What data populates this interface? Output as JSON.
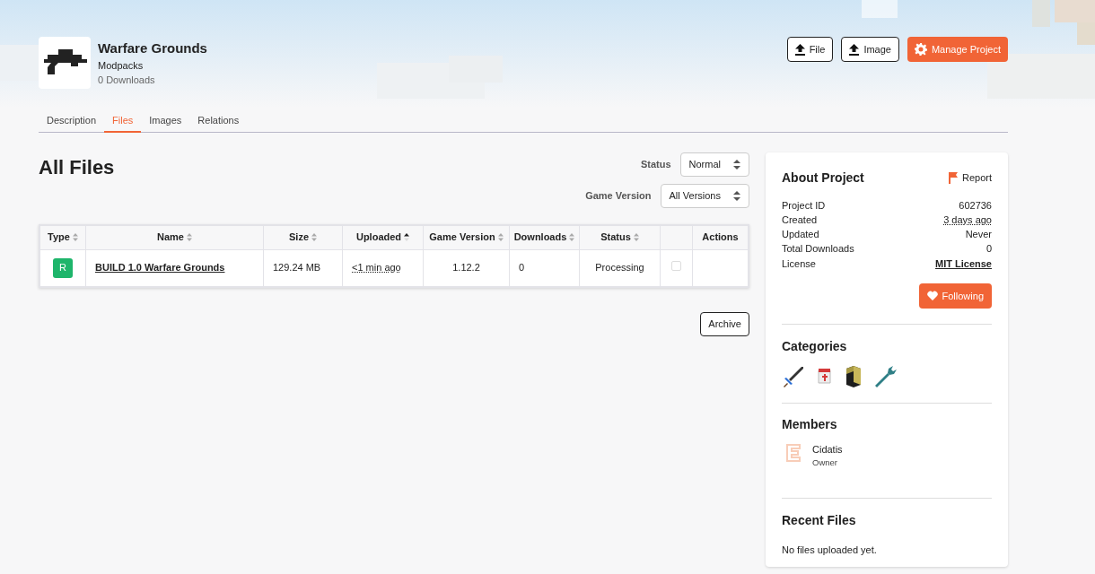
{
  "project": {
    "title": "Warfare Grounds",
    "category": "Modpacks",
    "downloads": "0 Downloads"
  },
  "header_buttons": [
    {
      "kind": "upload",
      "label": "File"
    },
    {
      "kind": "upload",
      "label": "Image"
    },
    {
      "kind": "manage",
      "label": "Manage Project"
    }
  ],
  "tabs": [
    {
      "label": "Description",
      "selected": false
    },
    {
      "label": "Files",
      "selected": true
    },
    {
      "label": "Images",
      "selected": false
    },
    {
      "label": "Relations",
      "selected": false
    }
  ],
  "heading": "All Files",
  "filters": [
    {
      "label": "Status",
      "value": "Normal"
    },
    {
      "label": "Game Version",
      "value": "All Versions"
    }
  ],
  "table": {
    "columns": [
      {
        "kind": "text",
        "label": "Type",
        "sorted": false
      },
      {
        "kind": "text",
        "label": "Name",
        "sorted": false
      },
      {
        "kind": "text",
        "label": "Size",
        "sorted": false
      },
      {
        "kind": "text",
        "label": "Uploaded",
        "sorted": true
      },
      {
        "kind": "text",
        "label": "Game Version",
        "sorted": false
      },
      {
        "kind": "text",
        "label": "Downloads",
        "sorted": false
      },
      {
        "kind": "text",
        "label": "Status",
        "sorted": false
      },
      {
        "kind": "select"
      },
      {
        "kind": "text",
        "label": "Actions"
      }
    ],
    "rows": [
      {
        "type": "R",
        "name": "BUILD 1.0 Warfare Grounds",
        "size": "129.24 MB",
        "uploaded": "<1 min ago",
        "game_version": "1.12.2",
        "downloads": "0",
        "status": "Processing",
        "checked": false
      }
    ]
  },
  "archive_button": "Archive",
  "about": {
    "title": "About Project",
    "report": "Report",
    "facts": [
      {
        "label": "Project ID",
        "value": "602736",
        "kind": "plain"
      },
      {
        "label": "Created",
        "value": "3 days ago",
        "kind": "time"
      },
      {
        "label": "Updated",
        "value": "Never",
        "kind": "plain"
      },
      {
        "label": "Total Downloads",
        "value": "0",
        "kind": "plain"
      },
      {
        "label": "License",
        "value": "MIT License",
        "kind": "link"
      }
    ],
    "follow_button": "Following"
  },
  "categories_title": "Categories",
  "members_title": "Members",
  "members": [
    {
      "name": "Cidatis",
      "role": "Owner"
    }
  ],
  "recent_files": {
    "title": "Recent Files",
    "empty_text": "No files uploaded yet."
  }
}
